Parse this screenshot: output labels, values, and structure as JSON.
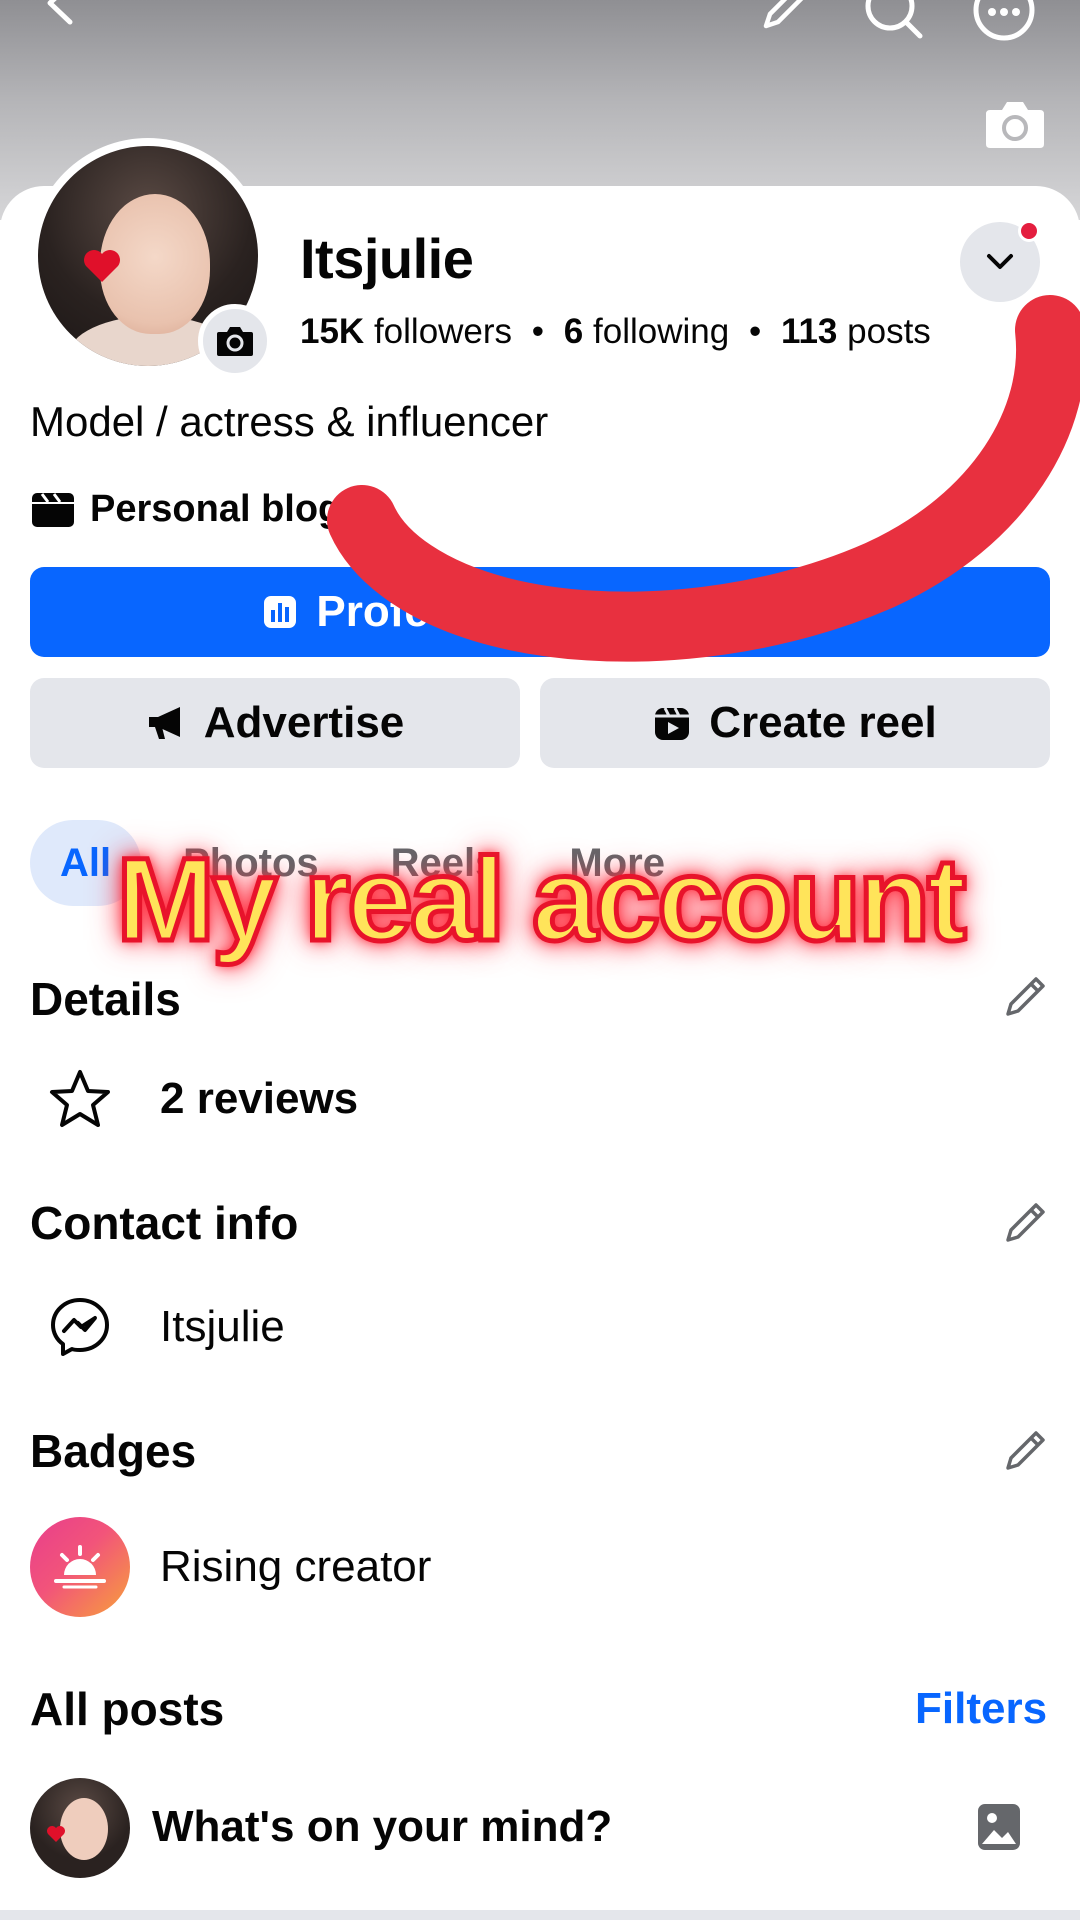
{
  "profile": {
    "name": "Itsjulie",
    "followers_count": "15K",
    "followers_label": "followers",
    "following_count": "6",
    "following_label": "following",
    "posts_count": "113",
    "posts_label": "posts",
    "separator": "•",
    "bio": "Model / actress & influencer",
    "category": "Personal blog"
  },
  "buttons": {
    "professional": "Professional dashboard",
    "professional_visible": "Professio",
    "professional_tail": "ard",
    "advertise": "Advertise",
    "create_reel": "Create reel"
  },
  "tabs": [
    {
      "label": "All",
      "active": true
    },
    {
      "label": "Photos",
      "active": false
    },
    {
      "label": "Reels",
      "active": false
    },
    {
      "label": "More",
      "active": false
    }
  ],
  "overlay_caption": "My real account",
  "details": {
    "title": "Details",
    "reviews": "2 reviews"
  },
  "contact": {
    "title": "Contact info",
    "messenger": "Itsjulie"
  },
  "badges": {
    "title": "Badges",
    "badge": "Rising creator"
  },
  "posts": {
    "title": "All posts",
    "filters": "Filters",
    "composer_prompt": "What's on your mind?"
  },
  "colors": {
    "accent": "#0866ff",
    "button_gray": "#e4e6eb",
    "scribble_red": "#e8303f",
    "overlay_yellow": "#ffe45a"
  }
}
